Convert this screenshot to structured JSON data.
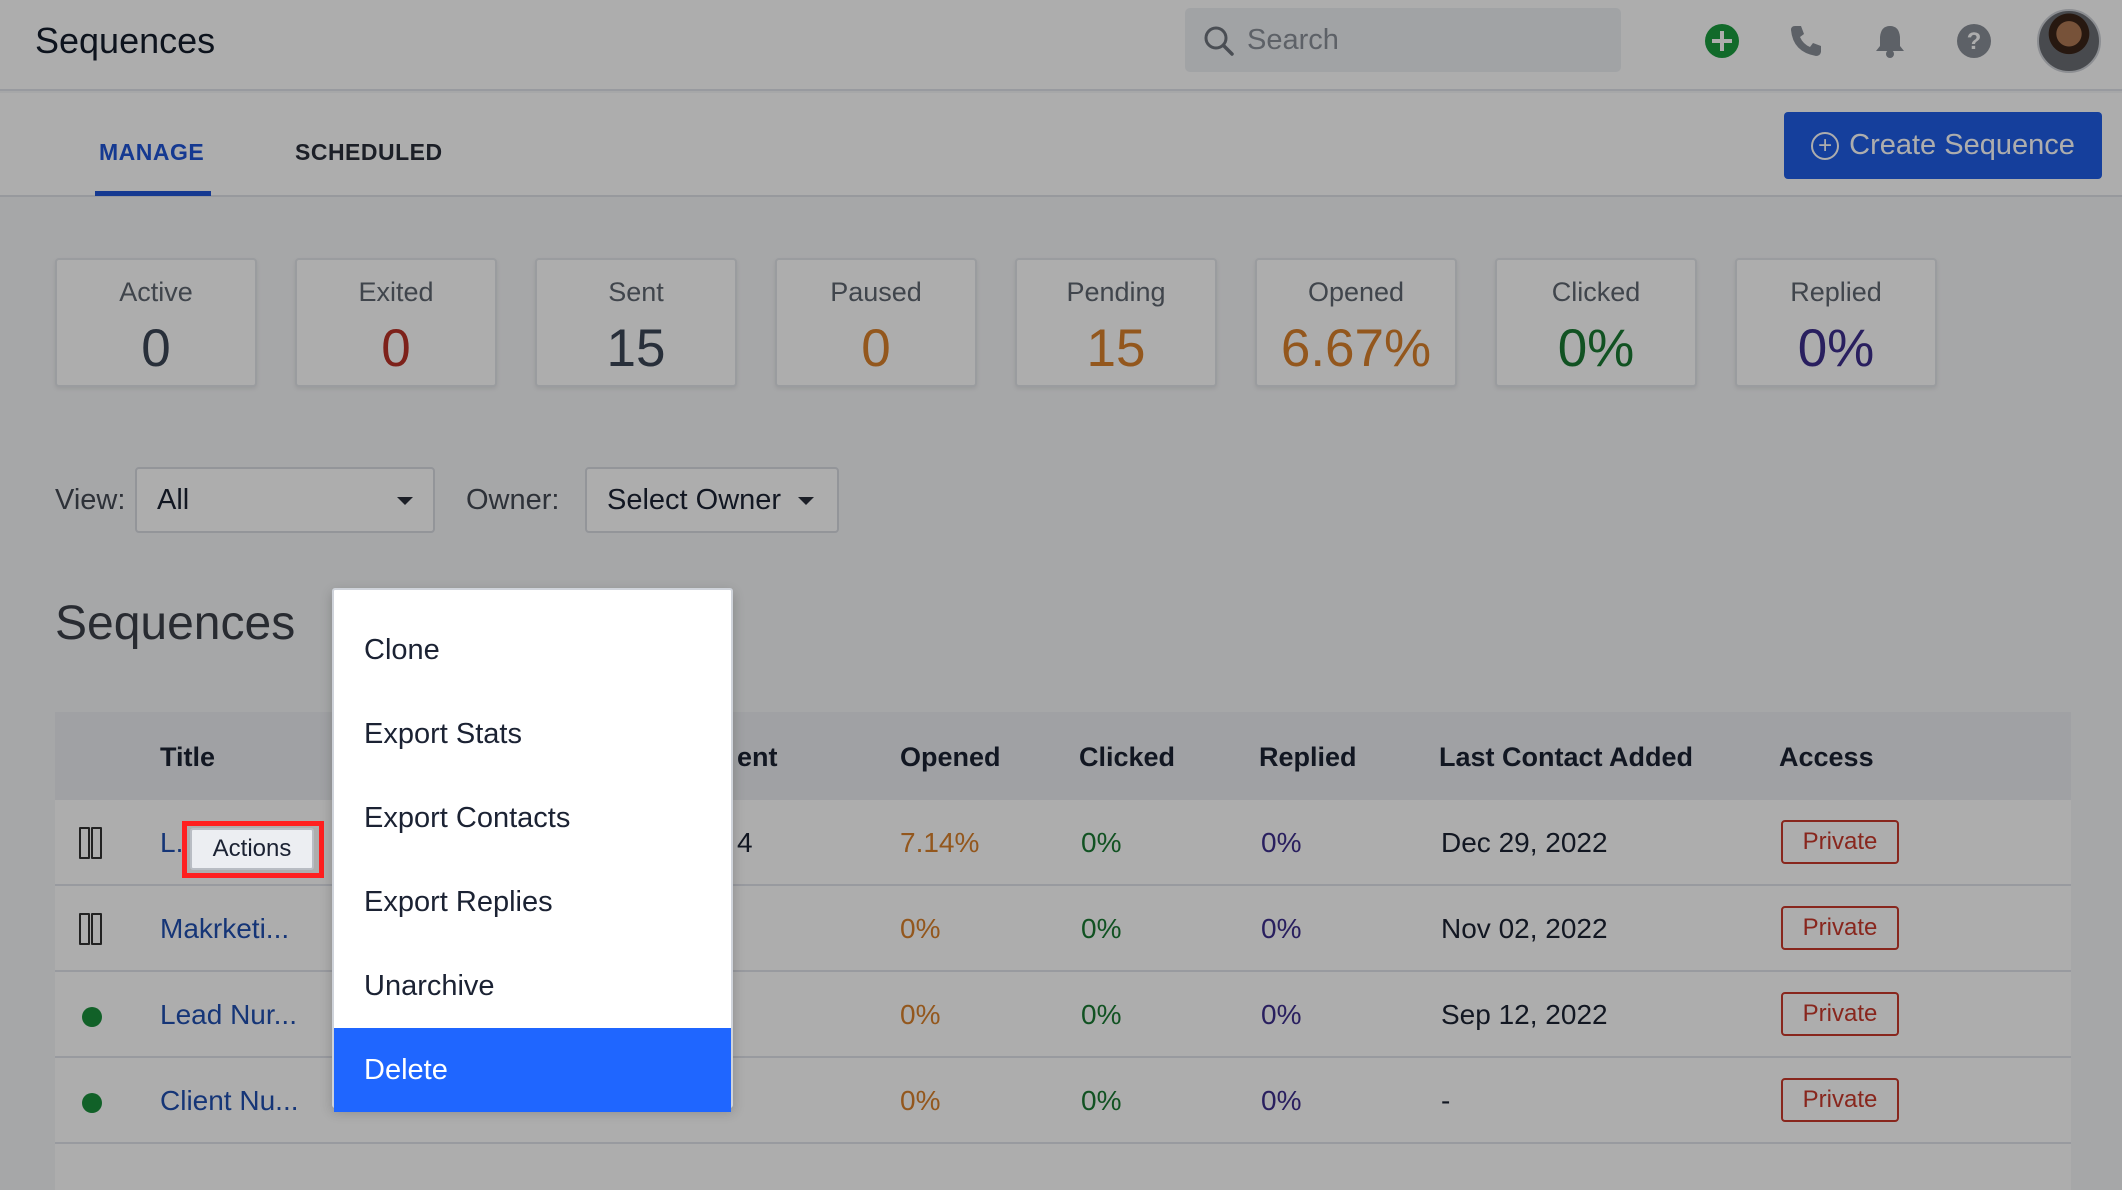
{
  "header": {
    "title": "Sequences",
    "search_placeholder": "Search"
  },
  "tabs": [
    {
      "label": "MANAGE",
      "active": true
    },
    {
      "label": "SCHEDULED",
      "active": false
    }
  ],
  "create_button": "Create Sequence",
  "stats": [
    {
      "label": "Active",
      "value": "0",
      "color": "#3c4656"
    },
    {
      "label": "Exited",
      "value": "0",
      "color": "#b83227"
    },
    {
      "label": "Sent",
      "value": "15",
      "color": "#3c4656"
    },
    {
      "label": "Paused",
      "value": "0",
      "color": "#d9812b"
    },
    {
      "label": "Pending",
      "value": "15",
      "color": "#d9812b"
    },
    {
      "label": "Opened",
      "value": "6.67%",
      "color": "#d9812b"
    },
    {
      "label": "Clicked",
      "value": "0%",
      "color": "#1a7a33"
    },
    {
      "label": "Replied",
      "value": "0%",
      "color": "#3d2e8c"
    }
  ],
  "filters": {
    "view_label": "View:",
    "view_value": "All",
    "owner_label": "Owner:",
    "owner_value": "Select Owner"
  },
  "section_title": "Sequences",
  "table": {
    "headers": {
      "title": "Title",
      "sent_partial": "ent",
      "opened": "Opened",
      "clicked": "Clicked",
      "replied": "Replied",
      "last_contact": "Last Contact Added",
      "access": "Access"
    },
    "rows": [
      {
        "status": "paused",
        "title": "L.",
        "sent": "4",
        "opened": "7.14%",
        "clicked": "0%",
        "replied": "0%",
        "last_contact": "Dec 29, 2022",
        "access": "Private"
      },
      {
        "status": "paused",
        "title": "Makrketi...",
        "sent": "",
        "opened": "0%",
        "clicked": "0%",
        "replied": "0%",
        "last_contact": "Nov 02, 2022",
        "access": "Private"
      },
      {
        "status": "active",
        "title": "Lead Nur...",
        "sent": "",
        "opened": "0%",
        "clicked": "0%",
        "replied": "0%",
        "last_contact": "Sep 12, 2022",
        "access": "Private"
      },
      {
        "status": "active",
        "title": "Client Nu...",
        "sent": "",
        "opened": "0%",
        "clicked": "0%",
        "replied": "0%",
        "last_contact": "-",
        "access": "Private"
      }
    ]
  },
  "actions_tag": "Actions",
  "menu": {
    "items": [
      "Clone",
      "Export Stats",
      "Export Contacts",
      "Export Replies",
      "Unarchive",
      "Delete"
    ],
    "active_index": 5
  },
  "colors": {
    "accent": "#1f5ee6",
    "opened": "#d9812b",
    "clicked": "#1a7a33",
    "replied": "#3d2e8c",
    "private": "#c9392b",
    "menu_active": "#1f66ff"
  }
}
